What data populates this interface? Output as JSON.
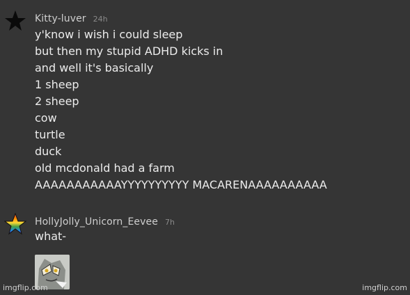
{
  "messages": [
    {
      "username": "Kitty-luver",
      "time": "24h",
      "avatar_icon": "black-star-icon",
      "lines": [
        "y'know i wish i could sleep",
        "but then my stupid ADHD kicks in",
        "and well it's basically",
        "1 sheep",
        "2 sheep",
        "cow",
        "turtle",
        "duck",
        "old mcdonald had a farm",
        "AAAAAAAAAAAYYYYYYYYYY MACARENAAAAAAAAAA"
      ]
    },
    {
      "username": "HollyJolly_Unicorn_Eevee",
      "time": "7h",
      "avatar_icon": "rainbow-star-icon",
      "lines": [
        "what-"
      ],
      "attachment_icon": "cartoon-cat-meme-image"
    }
  ],
  "watermark": {
    "left": "imgflip.com",
    "right": "imgflip.com"
  },
  "colors": {
    "background": "#353535",
    "text": "#ececec",
    "timestamp": "#8a8a8a"
  }
}
